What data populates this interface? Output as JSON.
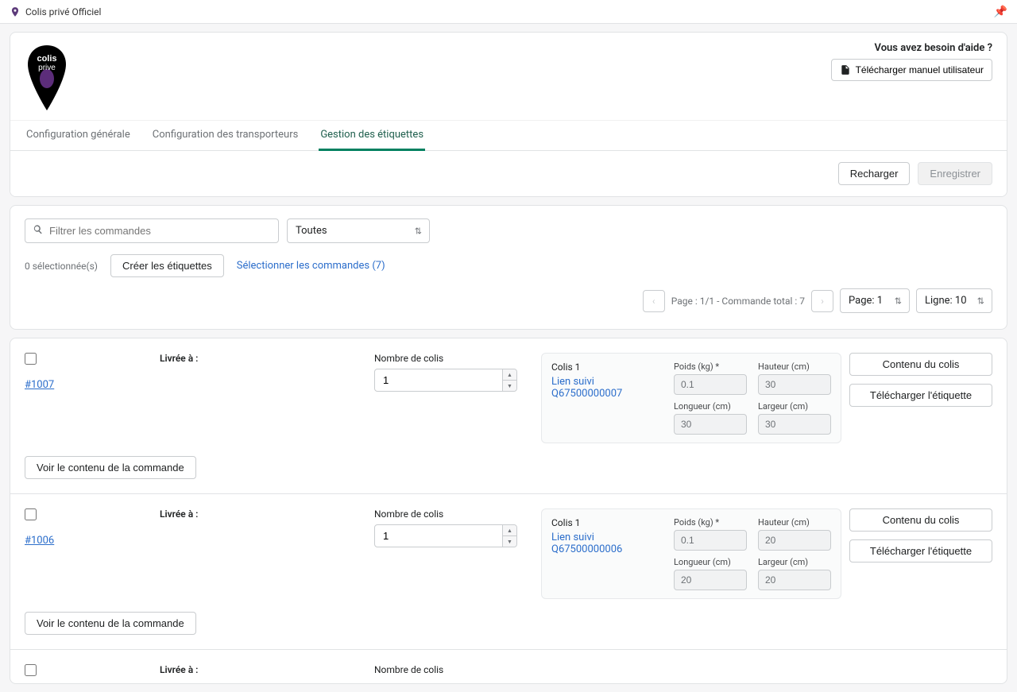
{
  "topbar": {
    "title": "Colis privé Officiel"
  },
  "header": {
    "help_text": "Vous avez besoin d'aide ?",
    "download_manual": "Télécharger manuel utilisateur"
  },
  "tabs": {
    "items": [
      {
        "label": "Configuration générale"
      },
      {
        "label": "Configuration des transporteurs"
      },
      {
        "label": "Gestion des étiquettes"
      }
    ]
  },
  "actions": {
    "reload": "Recharger",
    "save": "Enregistrer"
  },
  "filter": {
    "search_placeholder": "Filtrer les commandes",
    "status_value": "Toutes"
  },
  "selection": {
    "selected_text": "0 sélectionnée(s)",
    "create_labels": "Créer les étiquettes",
    "select_orders": "Sélectionner les commandes (7)"
  },
  "pagination": {
    "status": "Page : 1/1 - Commande total : 7",
    "page_select": "Page: 1",
    "line_select": "Ligne: 10"
  },
  "order_labels": {
    "delivered_to": "Livrée à :",
    "nb_colis": "Nombre de colis",
    "colis_title": "Colis 1",
    "weight": "Poids (kg) *",
    "height": "Hauteur (cm)",
    "length": "Longueur (cm)",
    "width": "Largeur (cm)",
    "content": "Contenu du colis",
    "download_label": "Télécharger l'étiquette",
    "view_order": "Voir le contenu de la commande"
  },
  "orders": [
    {
      "id": "#1007",
      "nb_colis": "1",
      "tracking_label": "Lien suivi Q67500000007",
      "weight": "0.1",
      "height": "30",
      "length": "30",
      "width": "30"
    },
    {
      "id": "#1006",
      "nb_colis": "1",
      "tracking_label": "Lien suivi Q67500000006",
      "weight": "0.1",
      "height": "20",
      "length": "20",
      "width": "20"
    },
    {
      "id": "",
      "nb_colis": "",
      "tracking_label": "",
      "weight": "",
      "height": "",
      "length": "",
      "width": ""
    }
  ]
}
